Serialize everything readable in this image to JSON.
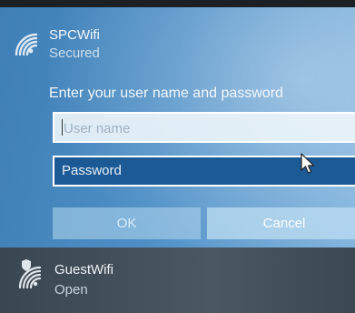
{
  "selected_network": {
    "ssid": "SPCWifi",
    "status": "Secured",
    "icon": "wifi-secured-icon"
  },
  "credentials_form": {
    "prompt": "Enter your user name and password",
    "username_placeholder": "User name",
    "username_value": "",
    "password_placeholder": "Password",
    "password_value": ""
  },
  "buttons": {
    "ok_label": "OK",
    "cancel_label": "Cancel"
  },
  "other_networks": [
    {
      "ssid": "GuestWifi",
      "status": "Open",
      "icon": "wifi-open-shield-icon"
    }
  ],
  "colors": {
    "accent": "#4d8fc6",
    "password_field_bg": "#1b5a95",
    "list_bg": "#3a4650"
  }
}
